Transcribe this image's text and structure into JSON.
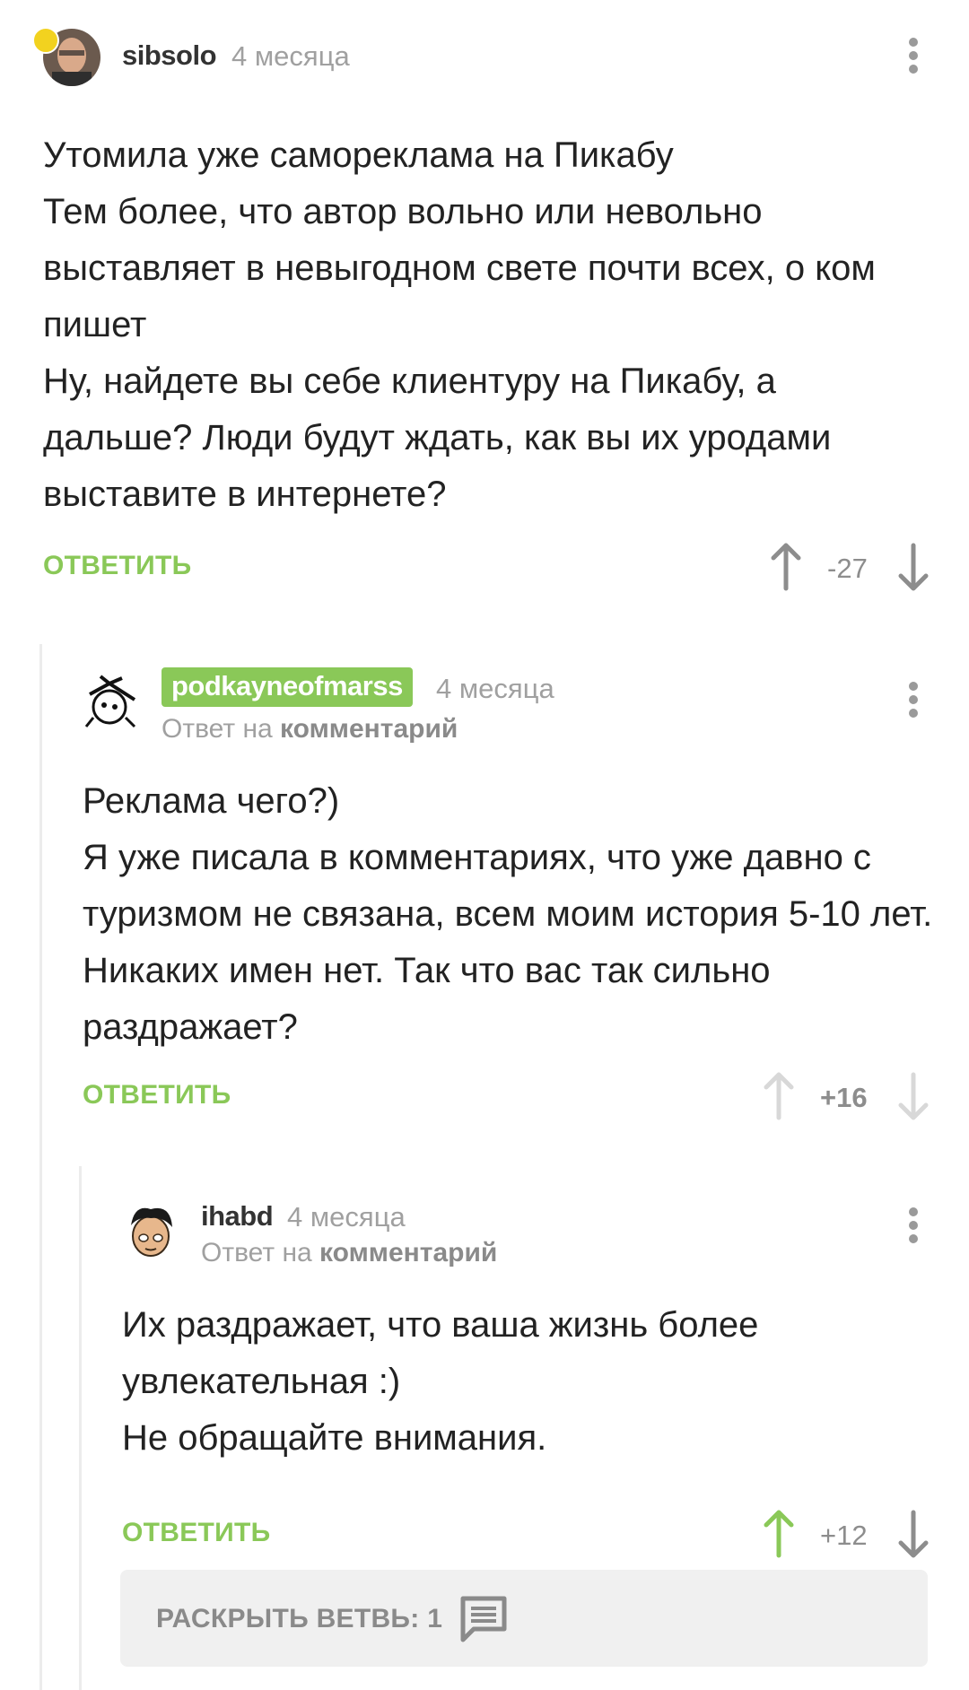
{
  "comments": [
    {
      "username": "sibsolo",
      "time": "4 месяца",
      "reply_to": null,
      "text": "Утомила уже самореклама на Пикабу\nТем более, что автор вольно или невольно выставляет в невыгодном свете почти всех, о ком пишет\nНу, найдете вы себе клиентуру на Пикабу, а дальше? Люди будут ждать, как вы их уродами выставите в интернете?",
      "reply_label": "ОТВЕТИТЬ",
      "score": "-27",
      "vote_state": "none"
    },
    {
      "username": "podkayneofmarss",
      "time": "4 месяца",
      "reply_to": {
        "prefix": "Ответ на",
        "link": "комментарий"
      },
      "text": "Реклама чего?)\nЯ уже писала в комментариях, что уже давно с туризмом не связана, всем моим история 5-10 лет. Никаких имен нет. Так что вас так сильно раздражает?",
      "reply_label": "ОТВЕТИТЬ",
      "score": "+16",
      "vote_state": "own"
    },
    {
      "username": "ihabd",
      "time": "4 месяца",
      "reply_to": {
        "prefix": "Ответ на",
        "link": "комментарий"
      },
      "text": "Их раздражает, что ваша жизнь более увлекательная :)\nНе обращайте внимания.",
      "reply_label": "ОТВЕТИТЬ",
      "score": "+12",
      "vote_state": "up"
    }
  ],
  "expand_branch": {
    "label": "РАСКРЫТЬ ВЕТВЬ: 1",
    "icon": "comment-icon"
  },
  "colors": {
    "accent": "#8ac858",
    "muted": "#a0a0a0",
    "text": "#222222",
    "pin": "#f2d21f"
  }
}
